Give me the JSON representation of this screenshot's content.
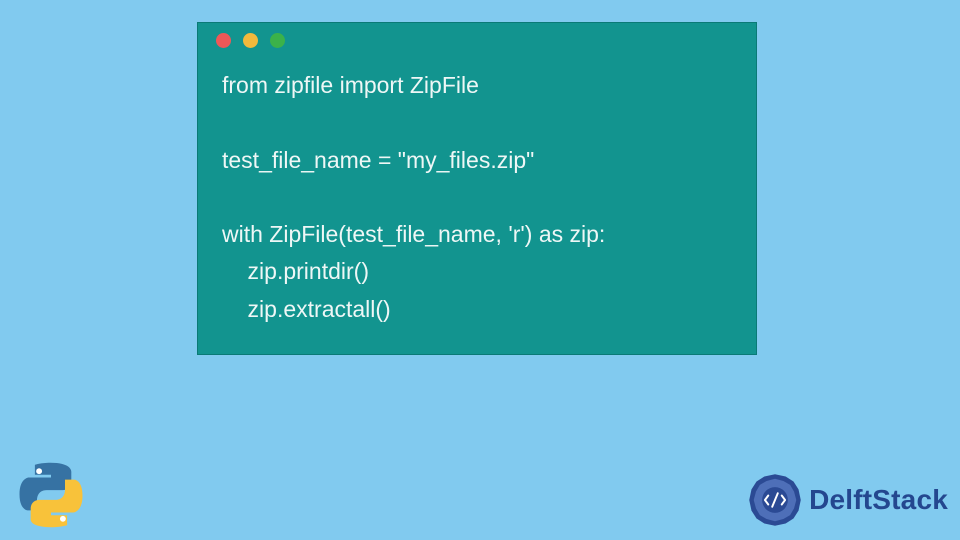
{
  "code": {
    "lines": [
      "from zipfile import ZipFile",
      "",
      "test_file_name = \"my_files.zip\"",
      "",
      "with ZipFile(test_file_name, 'r') as zip:",
      "    zip.printdir()",
      "    zip.extractall()"
    ],
    "window_dots": [
      "red",
      "yellow",
      "green"
    ]
  },
  "brand": {
    "name": "DelftStack",
    "color": "#24478f"
  },
  "icons": {
    "python": "python-logo-icon",
    "delft": "delftstack-badge-icon"
  },
  "colors": {
    "page_bg": "#81caef",
    "window_bg": "#12948f",
    "code_fg": "#eef7f6"
  }
}
